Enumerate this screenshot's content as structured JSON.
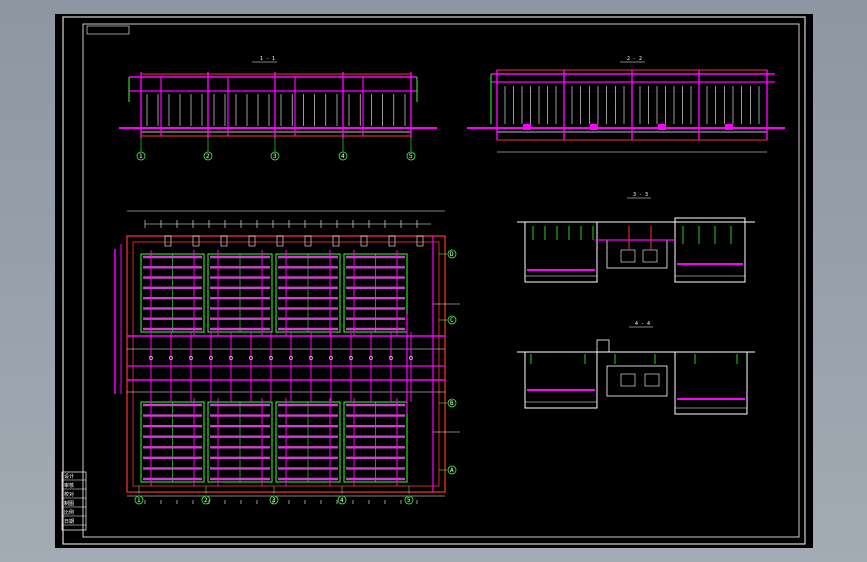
{
  "drawing": {
    "colors": {
      "background": "#000000",
      "frame": "#ffffff",
      "pipe": "#ff00ff",
      "panel": "#cc44cc",
      "outline": "#ff3333",
      "green": "#33ff33",
      "wall": "#ffffff"
    },
    "views": {
      "view1_title": "1 - 1",
      "view2_title": "2 - 2",
      "view3_title": "3 - 3",
      "view4_title": "4 - 4"
    },
    "axes_bottom": [
      "1",
      "2",
      "3",
      "4",
      "5"
    ],
    "axes_right": [
      "D",
      "C",
      "B",
      "A"
    ],
    "title_block": {
      "rows": [
        "设计",
        "审核",
        "校对",
        "制图",
        "比例",
        "日期"
      ]
    }
  }
}
